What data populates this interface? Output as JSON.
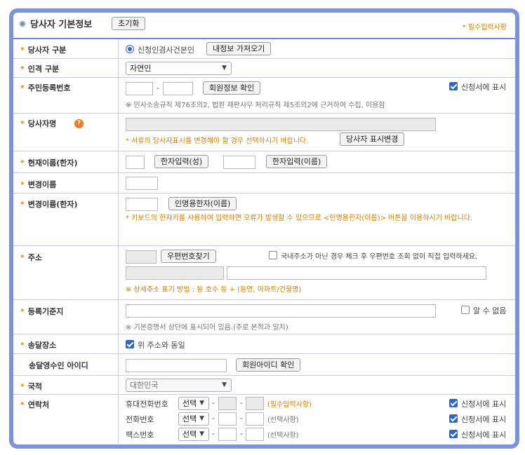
{
  "header": {
    "title": "당사자 기본정보",
    "reset_label": "초기화",
    "required_note": "* 필수입력사항"
  },
  "party_type": {
    "label": "당사자 구분",
    "radio_label": "신청인겸사건본인",
    "load_button": "내정보 가져오기"
  },
  "person_type": {
    "label": "인격 구분",
    "selected": "자연인"
  },
  "rrn": {
    "label": "주민등록번호",
    "dash": "-",
    "verify_button": "회원정보 확인",
    "show_label": "신청서에 표시",
    "note": "※ 민사소송규칙 제76조의2, 법원 재판사무 처리규칙 제5조의2에 근거하여 수집, 이용함"
  },
  "party_name": {
    "label": "당사자명",
    "help_icon": "?",
    "note": "* 서류의 당사자표시를 변경해야 할 경우 선택하시기 바랍니다.",
    "change_button": "당사자 표시변경"
  },
  "hanja_name": {
    "label": "현재이름(한자)",
    "surname_button": "한자입력(성)",
    "given_button": "한자입력(이름)"
  },
  "changed_name": {
    "label": "변경이름"
  },
  "changed_hanja": {
    "label": "변경이름(한자)",
    "button": "인명용한자(이름)",
    "note": "* 키보드의 한자키를 사용하여 입력하면 오류가 발생할 수 있으므로 <인명용한자(이름)> 버튼을 이용하시기 바랍니다."
  },
  "address": {
    "label": "주소",
    "zip_button": "우편번호찾기",
    "manual_label": "국내주소가 아닌 경우 체크 후 우편번호 조회 없이 직접 입력하세요.",
    "note": "※ 상세주소 표기 방법 : 동 호수 등 + (동명, 아파트/건물명)"
  },
  "registry": {
    "label": "등록기준지",
    "unknown_label": "알 수 없음",
    "note": "※ 기본증명서 상단에 표시되어 있음.(주로 본적과 일치)"
  },
  "delivery": {
    "label": "송달장소",
    "same_label": "위 주소와 동일"
  },
  "delivery_id": {
    "label": "송달영수인 아이디",
    "verify_button": "회원아이디 확인"
  },
  "nationality": {
    "label": "국적",
    "selected": "대한민국"
  },
  "contact": {
    "label": "연락처",
    "show_label": "신청서에 표시",
    "rows": [
      {
        "label": "휴대전화번호",
        "select": "선택",
        "note": "(필수입력사항)"
      },
      {
        "label": "전화번호",
        "select": "선택",
        "note": "(선택사항)"
      },
      {
        "label": "팩스번호",
        "select": "선택",
        "note": "(선택사항)"
      }
    ]
  },
  "colors": {
    "frame": "#7b93da",
    "accent": "#d47e00",
    "check": "#2f66c8"
  }
}
